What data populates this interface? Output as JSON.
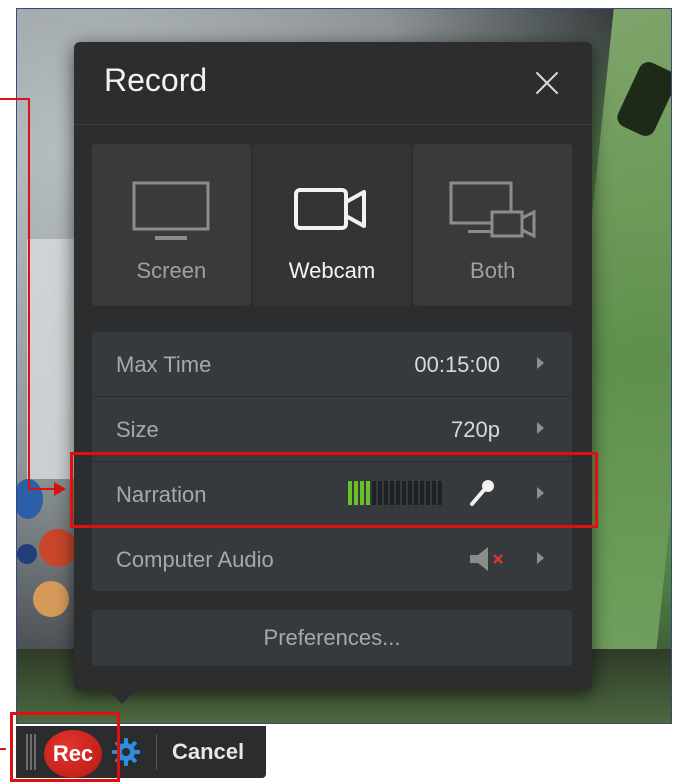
{
  "dialog": {
    "title": "Record",
    "close_icon": "close-icon"
  },
  "modes": [
    {
      "label": "Screen",
      "icon": "monitor-icon",
      "selected": false
    },
    {
      "label": "Webcam",
      "icon": "webcam-icon",
      "selected": true
    },
    {
      "label": "Both",
      "icon": "screen-and-webcam-icon",
      "selected": false
    }
  ],
  "settings": {
    "max_time": {
      "label": "Max Time",
      "value": "00:15:00"
    },
    "size": {
      "label": "Size",
      "value": "720p"
    },
    "narration": {
      "label": "Narration",
      "level_bars_on": 4,
      "level_bars_total": 16,
      "icon": "microphone-icon"
    },
    "computer_audio": {
      "label": "Computer Audio",
      "icon": "speaker-muted-icon"
    }
  },
  "preferences": {
    "label": "Preferences..."
  },
  "toolbar": {
    "rec_label": "Rec",
    "settings_icon": "gear-icon",
    "cancel_label": "Cancel"
  },
  "colors": {
    "dialog_bg": "#2b2d2f",
    "row_bg": "#373a3c",
    "rec_red": "#d0201a",
    "meter_green": "#69c12a",
    "highlight_red": "#e01010",
    "gear_blue": "#2f8de0"
  }
}
